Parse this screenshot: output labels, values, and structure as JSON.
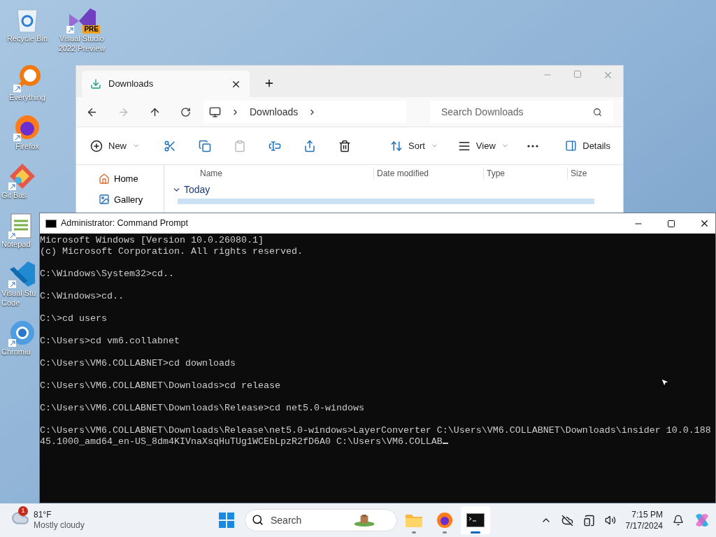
{
  "desktop_icons": [
    {
      "kind": "recycle",
      "lines": [
        "Recycle Bin"
      ],
      "shortcut": false
    },
    {
      "kind": "vs",
      "lines": [
        "Visual Studio",
        "2022 Preview"
      ],
      "shortcut": true,
      "badge": "PRE"
    },
    {
      "kind": "everything",
      "lines": [
        "Everything"
      ],
      "shortcut": true
    },
    {
      "kind": "firefox",
      "lines": [
        "Firefox"
      ],
      "shortcut": true
    },
    {
      "kind": "git",
      "lines": [
        "Git Bas"
      ],
      "shortcut": true
    },
    {
      "kind": "notepad",
      "lines": [
        "Notepad"
      ],
      "shortcut": true
    },
    {
      "kind": "vscode",
      "lines": [
        "Visual Stu",
        "Code"
      ],
      "shortcut": true
    },
    {
      "kind": "chromium",
      "lines": [
        "Chromiu"
      ],
      "shortcut": true
    }
  ],
  "explorer": {
    "tab_title": "Downloads",
    "breadcrumb": [
      "Downloads"
    ],
    "search": {
      "placeholder": "Search Downloads"
    },
    "toolbar": [
      {
        "kind": "new",
        "label": "New",
        "disabled": false
      },
      {
        "kind": "cut",
        "disabled": false
      },
      {
        "kind": "copy",
        "disabled": false
      },
      {
        "kind": "paste",
        "disabled": true
      },
      {
        "kind": "rename",
        "disabled": false
      },
      {
        "kind": "share",
        "disabled": false
      },
      {
        "kind": "delete",
        "disabled": false
      },
      {
        "kind": "sort",
        "label": "Sort",
        "disabled": false
      },
      {
        "kind": "view",
        "label": "View",
        "disabled": false
      },
      {
        "kind": "more",
        "disabled": false
      }
    ],
    "details_label": "Details",
    "sidebar": [
      {
        "kind": "home",
        "label": "Home"
      },
      {
        "kind": "gallery",
        "label": "Gallery"
      }
    ],
    "columns": [
      "Name",
      "Date modified",
      "Type",
      "Size"
    ],
    "group": "Today"
  },
  "cmd": {
    "title": "Administrator: Command Prompt",
    "blocks": [
      [
        "Microsoft Windows [Version 10.0.26080.1]",
        "(c) Microsoft Corporation. All rights reserved."
      ],
      [
        "C:\\Windows\\System32>cd.."
      ],
      [
        "C:\\Windows>cd.."
      ],
      [
        "C:\\>cd users"
      ],
      [
        "C:\\Users>cd vm6.collabnet"
      ],
      [
        "C:\\Users\\VM6.COLLABNET>cd downloads"
      ],
      [
        "C:\\Users\\VM6.COLLABNET\\Downloads>cd release"
      ],
      [
        "C:\\Users\\VM6.COLLABNET\\Downloads\\Release>cd net5.0-windows"
      ],
      [
        "C:\\Users\\VM6.COLLABNET\\Downloads\\Release\\net5.0-windows>LayerConverter C:\\Users\\VM6.COLLABNET\\Downloads\\insider 10.0.188",
        "45.1000_amd64_en-US_8dm4KIVnaXsqHuTUg1WCEbLpzR2fD6A0 C:\\Users\\VM6.COLLAB"
      ]
    ]
  },
  "taskbar": {
    "weather": {
      "alert_count": "1",
      "temperature": "81°F",
      "condition": "Mostly cloudy"
    },
    "search": {
      "placeholder": "Search"
    },
    "apps": [
      {
        "kind": "widgets",
        "running": false,
        "selected": false
      },
      {
        "kind": "explorer",
        "running": true,
        "selected": false
      },
      {
        "kind": "firefox",
        "running": true,
        "selected": false
      },
      {
        "kind": "terminal",
        "running": true,
        "selected": true
      }
    ],
    "time": "7:15 PM",
    "date": "7/17/2024"
  }
}
